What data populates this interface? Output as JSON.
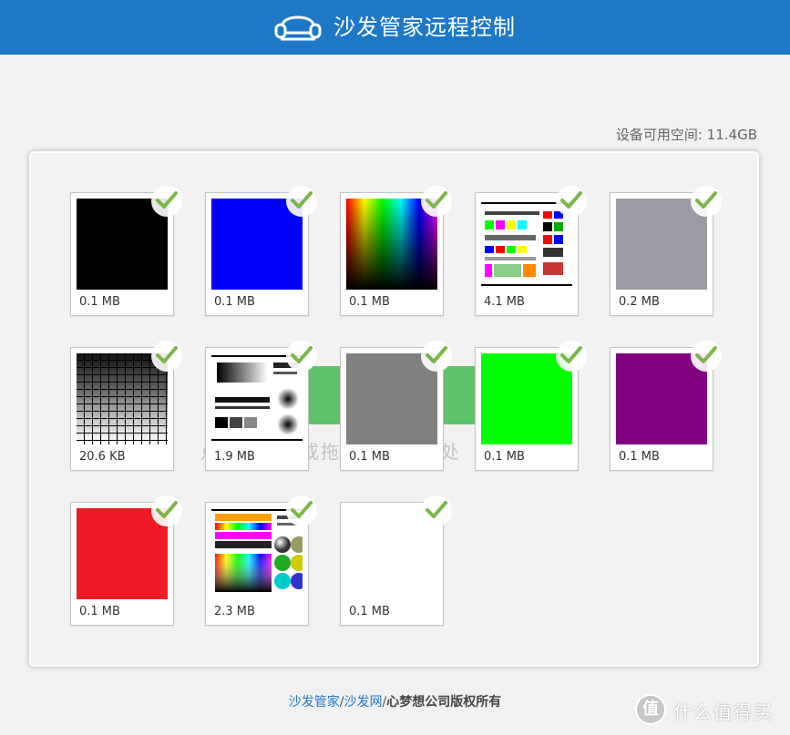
{
  "header": {
    "title": "沙发管家远程控制",
    "logo_icon": "sofa-icon",
    "bg_color": "#1e78c8"
  },
  "storage": {
    "label": "设备可用空间: 11.4GB"
  },
  "upload": {
    "hint": "点击上传，或拖拽文件至此处"
  },
  "accent": {
    "check": "#7ab648",
    "upload_button": "#5ec36a"
  },
  "files": [
    {
      "size": "0.1 MB",
      "kind": "solid-black",
      "selected": true
    },
    {
      "size": "0.1 MB",
      "kind": "solid-blue",
      "selected": true
    },
    {
      "size": "0.1 MB",
      "kind": "color-gradient",
      "selected": true
    },
    {
      "size": "4.1 MB",
      "kind": "test-pattern",
      "selected": true
    },
    {
      "size": "0.2 MB",
      "kind": "solid-gray-lilac",
      "selected": true
    },
    {
      "size": "20.6 KB",
      "kind": "gray-grid",
      "selected": true
    },
    {
      "size": "1.9 MB",
      "kind": "gray-ramp-pattern",
      "selected": true
    },
    {
      "size": "0.1 MB",
      "kind": "solid-gray",
      "selected": true
    },
    {
      "size": "0.1 MB",
      "kind": "solid-green",
      "selected": true
    },
    {
      "size": "0.1 MB",
      "kind": "solid-purple",
      "selected": true
    },
    {
      "size": "0.1 MB",
      "kind": "solid-red",
      "selected": true
    },
    {
      "size": "2.3 MB",
      "kind": "color-spheres",
      "selected": true
    },
    {
      "size": "0.1 MB",
      "kind": "solid-white",
      "selected": true
    }
  ],
  "footer": {
    "link1": "沙发管家",
    "sep1": "/",
    "link2": "沙发网",
    "sep2": "/",
    "company": "心梦想公司版权所有"
  },
  "watermark": {
    "badge": "值",
    "text": "什么值得买"
  }
}
